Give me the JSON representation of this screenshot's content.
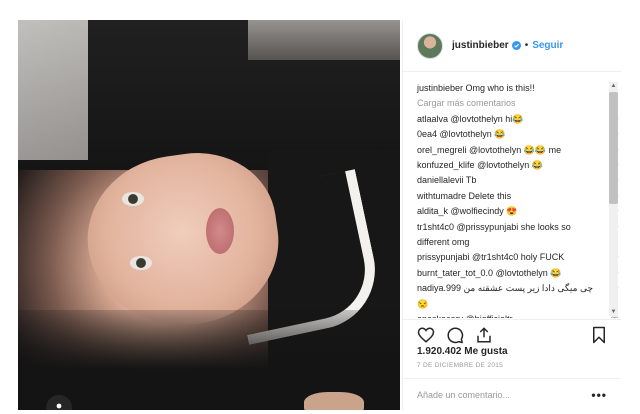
{
  "post": {
    "photo_alt": "",
    "profile_badge_icon": "person-icon"
  },
  "header": {
    "username": "justinbieber",
    "separator": "•",
    "follow_label": "Seguir",
    "verified_icon": "verified-badge-icon",
    "accent_color": "#3897f0"
  },
  "caption": {
    "user": "justinbieber",
    "text": "Omg who is this!!"
  },
  "load_more": "Cargar más comentarios",
  "comments": [
    {
      "user": "atlaalva",
      "text": "@lovtothelyn hi😂"
    },
    {
      "user": "0ea4",
      "text": "@lovtothelyn 😂"
    },
    {
      "user": "orel_megreli",
      "text": "@lovtothelyn 😂😂 me"
    },
    {
      "user": "konfuzed_klife",
      "text": "@lovtothelyn 😂"
    },
    {
      "user": "daniellalevii",
      "text": "Tb"
    },
    {
      "user": "withtumadre",
      "text": "Delete this"
    },
    {
      "user": "aldita_k",
      "text": "@wolfiecindy 😍"
    },
    {
      "user": "tr1sht4c0",
      "text": "@prissypunjabi she looks so different omg"
    },
    {
      "user": "prissypunjabi",
      "text": "@tr1sht4c0 holy FUCK"
    },
    {
      "user": "burnt_tater_tot_0.0",
      "text": "@lovtothelyn 😂"
    },
    {
      "user": "nadiya.999",
      "text": "چی میگی دادا زیر پست عشقته من 😒"
    },
    {
      "user": "enoskacary",
      "text": "@biofficialtr"
    }
  ],
  "actions": {
    "like_icon": "heart-icon",
    "comment_icon": "comment-icon",
    "share_icon": "share-icon",
    "save_icon": "bookmark-icon"
  },
  "likes": "1.920.402 Me gusta",
  "date": "7 DE DICIEMBRE DE 2015",
  "add_comment": {
    "placeholder": "Añade un comentario...",
    "more_label": "•••"
  }
}
